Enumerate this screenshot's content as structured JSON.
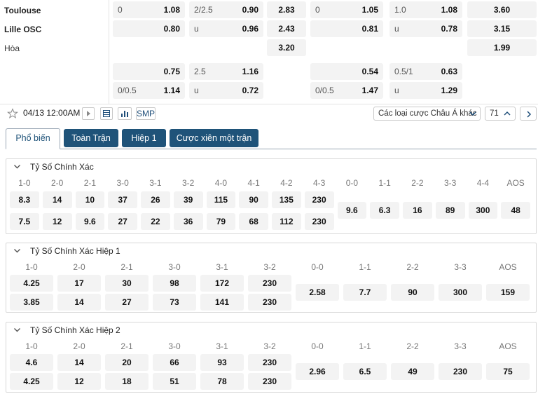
{
  "match": {
    "team_home": "Toulouse",
    "team_away": "Lille OSC",
    "draw_label": "Hòa",
    "rows": [
      [
        {
          "l": "0",
          "r": "1.08"
        },
        {
          "l": "2/2.5",
          "r": "0.90"
        },
        {
          "c": "2.83"
        },
        {
          "l": "0",
          "r": "1.05"
        },
        {
          "l": "1.0",
          "r": "1.08"
        },
        {
          "c": "3.60"
        }
      ],
      [
        {
          "l": "",
          "r": "0.80"
        },
        {
          "l": "u",
          "r": "0.96"
        },
        {
          "c": "2.43"
        },
        {
          "l": "",
          "r": "0.81"
        },
        {
          "l": "u",
          "r": "0.78"
        },
        {
          "c": "3.15"
        }
      ],
      [
        null,
        null,
        {
          "c": "3.20"
        },
        null,
        null,
        {
          "c": "1.99"
        }
      ],
      [
        {
          "l": "",
          "r": "0.75"
        },
        {
          "l": "2.5",
          "r": "1.16"
        },
        null,
        {
          "l": "",
          "r": "0.54"
        },
        {
          "l": "0.5/1",
          "r": "0.63"
        },
        null
      ],
      [
        {
          "l": "0/0.5",
          "r": "1.14"
        },
        {
          "l": "u",
          "r": "0.72"
        },
        null,
        {
          "l": "0/0.5",
          "r": "1.47"
        },
        {
          "l": "u",
          "r": "1.29"
        },
        null
      ]
    ]
  },
  "toolbar": {
    "datetime": "04/13 12:00AM",
    "smp_label": "SMP",
    "market_select": "Các loại cược Châu Á khác",
    "count": "71"
  },
  "tabs": [
    {
      "label": "Phổ biến",
      "active": true
    },
    {
      "label": "Toàn Trận",
      "active": false
    },
    {
      "label": "Hiệp 1",
      "active": false
    },
    {
      "label": "Cược xiên một trận",
      "active": false
    }
  ],
  "sections": [
    {
      "title": "Tỷ Số Chính Xác",
      "pairs": [
        {
          "label": "1-0",
          "top": "8.3",
          "bottom": "7.5"
        },
        {
          "label": "2-0",
          "top": "14",
          "bottom": "12"
        },
        {
          "label": "2-1",
          "top": "10",
          "bottom": "9.6"
        },
        {
          "label": "3-0",
          "top": "37",
          "bottom": "27"
        },
        {
          "label": "3-1",
          "top": "26",
          "bottom": "22"
        },
        {
          "label": "3-2",
          "top": "39",
          "bottom": "36"
        },
        {
          "label": "4-0",
          "top": "115",
          "bottom": "79"
        },
        {
          "label": "4-1",
          "top": "90",
          "bottom": "68"
        },
        {
          "label": "4-2",
          "top": "135",
          "bottom": "112"
        },
        {
          "label": "4-3",
          "top": "230",
          "bottom": "230"
        }
      ],
      "singles": [
        {
          "label": "0-0",
          "value": "9.6"
        },
        {
          "label": "1-1",
          "value": "6.3"
        },
        {
          "label": "2-2",
          "value": "16"
        },
        {
          "label": "3-3",
          "value": "89"
        },
        {
          "label": "4-4",
          "value": "300"
        },
        {
          "label": "AOS",
          "value": "48"
        }
      ]
    },
    {
      "title": "Tỷ Số Chính Xác Hiệp 1",
      "pairs": [
        {
          "label": "1-0",
          "top": "4.25",
          "bottom": "3.85"
        },
        {
          "label": "2-0",
          "top": "17",
          "bottom": "14"
        },
        {
          "label": "2-1",
          "top": "30",
          "bottom": "27"
        },
        {
          "label": "3-0",
          "top": "98",
          "bottom": "73"
        },
        {
          "label": "3-1",
          "top": "172",
          "bottom": "141"
        },
        {
          "label": "3-2",
          "top": "230",
          "bottom": "230"
        }
      ],
      "singles": [
        {
          "label": "0-0",
          "value": "2.58"
        },
        {
          "label": "1-1",
          "value": "7.7"
        },
        {
          "label": "2-2",
          "value": "90"
        },
        {
          "label": "3-3",
          "value": "300"
        },
        {
          "label": "AOS",
          "value": "159"
        }
      ]
    },
    {
      "title": "Tỷ Số Chính Xác Hiệp 2",
      "pairs": [
        {
          "label": "1-0",
          "top": "4.6",
          "bottom": "4.25"
        },
        {
          "label": "2-0",
          "top": "14",
          "bottom": "12"
        },
        {
          "label": "2-1",
          "top": "20",
          "bottom": "18"
        },
        {
          "label": "3-0",
          "top": "66",
          "bottom": "51"
        },
        {
          "label": "3-1",
          "top": "93",
          "bottom": "78"
        },
        {
          "label": "3-2",
          "top": "230",
          "bottom": "230"
        }
      ],
      "singles": [
        {
          "label": "0-0",
          "value": "2.96"
        },
        {
          "label": "1-1",
          "value": "6.5"
        },
        {
          "label": "2-2",
          "value": "49"
        },
        {
          "label": "3-3",
          "value": "230"
        },
        {
          "label": "AOS",
          "value": "75"
        }
      ]
    }
  ]
}
